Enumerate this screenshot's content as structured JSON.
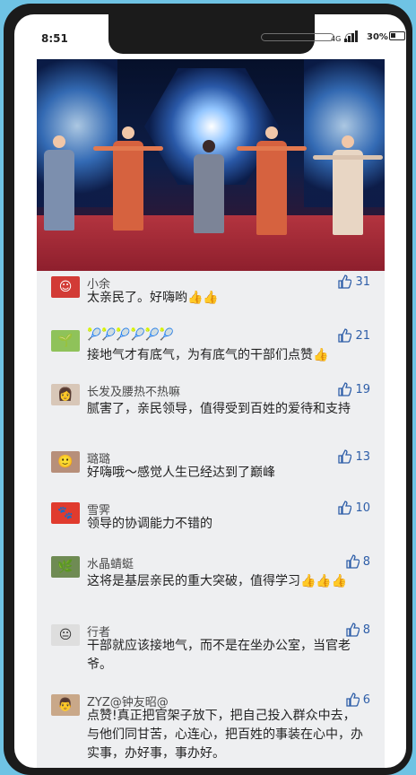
{
  "status_bar": {
    "time": "8:51",
    "network": "4G",
    "battery": "30%"
  },
  "photo": {
    "alt": ""
  },
  "comments": [
    {
      "name": "小余",
      "text": "太亲民了。好嗨哟👍👍",
      "likes": "31"
    },
    {
      "name": "🎾🎾🎾🎾🎾🎾",
      "text": "接地气才有底气，为有底气的干部们点赞👍",
      "likes": "21"
    },
    {
      "name": "长发及腰热不热嘛",
      "text": "腻害了，亲民领导，值得受到百姓的爱待和支持",
      "likes": "19"
    },
    {
      "name": "璐璐",
      "text": "好嗨哦～感觉人生已经达到了巅峰",
      "likes": "13"
    },
    {
      "name": "雪霁",
      "text": "领导的协调能力不错的",
      "likes": "10"
    },
    {
      "name": "水晶蜻蜓",
      "text": "这将是基层亲民的重大突破，值得学习👍👍👍",
      "likes": "8"
    },
    {
      "name": "行者",
      "text": "干部就应该接地气，而不是在坐办公室，当官老爷。",
      "likes": "8"
    },
    {
      "name": "ZYZ@钟友昭@",
      "text": "点赞!真正把官架子放下，把自己投入群众中去，与他们同甘苦，心连心，把百姓的事装在心中，办实事，办好事，事办好。",
      "likes": "6"
    }
  ],
  "colors": {
    "background": "#6fc3e4",
    "list_bg": "#eeeff1",
    "like_blue": "#2e5ea8"
  }
}
